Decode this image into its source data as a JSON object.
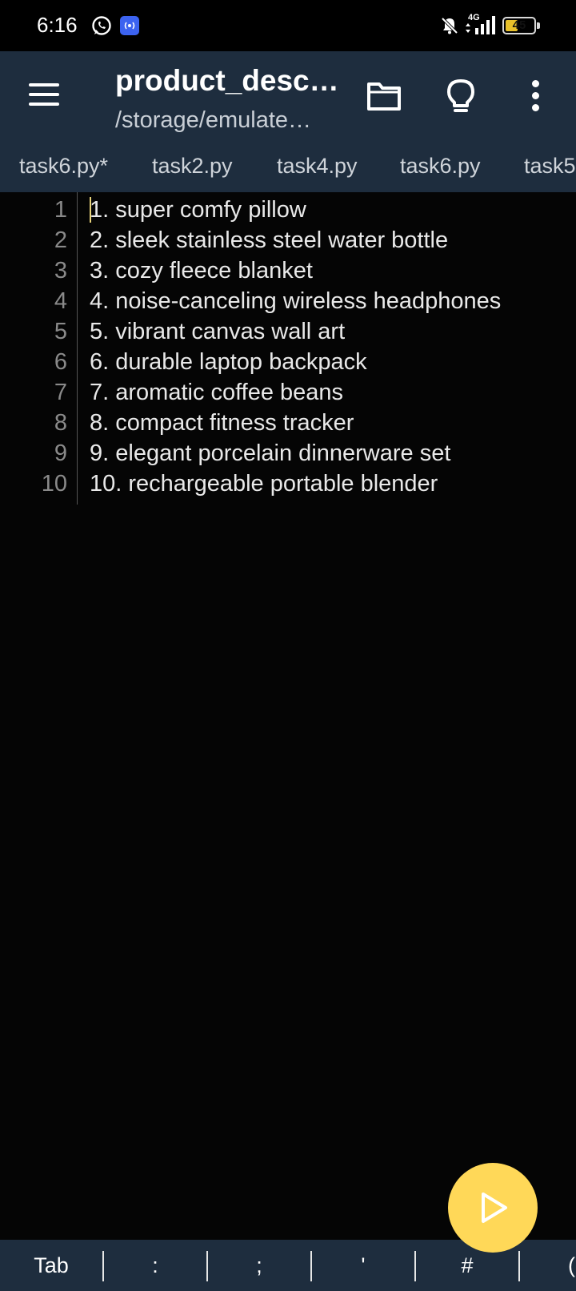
{
  "status_bar": {
    "time": "6:16",
    "network_label": "4G",
    "battery_level": 45,
    "battery_text": "45"
  },
  "app_bar": {
    "title": "product_desc…",
    "subtitle": "/storage/emulate…",
    "icons": [
      "menu-icon",
      "folder-icon",
      "lightbulb-icon",
      "more-vert-icon"
    ]
  },
  "tabs": [
    {
      "label": "task6.py*"
    },
    {
      "label": "task2.py"
    },
    {
      "label": "task4.py"
    },
    {
      "label": "task6.py"
    },
    {
      "label": "task5"
    }
  ],
  "editor": {
    "line_numbers": [
      "1",
      "2",
      "3",
      "4",
      "5",
      "6",
      "7",
      "8",
      "9",
      "10"
    ],
    "lines": [
      "1. super comfy pillow",
      "2. sleek stainless steel water bottle",
      "3. cozy fleece blanket",
      "4. noise-canceling wireless headphones",
      "5. vibrant canvas wall art",
      "6. durable laptop backpack",
      "7. aromatic coffee beans",
      "8. compact fitness tracker",
      "9. elegant porcelain dinnerware set",
      "10. rechargeable portable blender"
    ]
  },
  "fab": {
    "icon": "play-icon"
  },
  "extra_keys": [
    "Tab",
    ":",
    ";",
    "'",
    "#",
    "("
  ],
  "colors": {
    "app_bar": "#1e2d3e",
    "editor_bg": "#050505",
    "fab": "#ffd858",
    "cursor": "#e8d37a"
  }
}
